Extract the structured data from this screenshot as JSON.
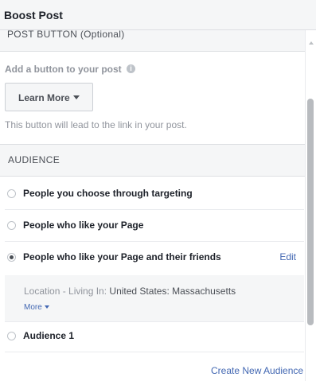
{
  "header": {
    "title": "Boost Post"
  },
  "post_button": {
    "section_title": "POST BUTTON (Optional)",
    "question": "Add a button to your post",
    "info_icon": "info-circle-icon",
    "selected_button": "Learn More",
    "helper_text": "This button will lead to the link in your post."
  },
  "audience": {
    "section_title": "AUDIENCE",
    "options": [
      {
        "label": "People you choose through targeting",
        "selected": false
      },
      {
        "label": "People who like your Page",
        "selected": false
      },
      {
        "label": "People who like your Page and their friends",
        "selected": true,
        "action": "Edit"
      },
      {
        "label": "Audience 1",
        "selected": false
      }
    ],
    "details": {
      "location_key": "Location - Living In:",
      "location_value": "United States: Massachusetts",
      "more_label": "More"
    },
    "create_label": "Create New Audience"
  },
  "colors": {
    "link": "#4267b2",
    "section_bg": "#f5f6f7",
    "text_primary": "#1d2129",
    "text_muted": "#90949c"
  }
}
